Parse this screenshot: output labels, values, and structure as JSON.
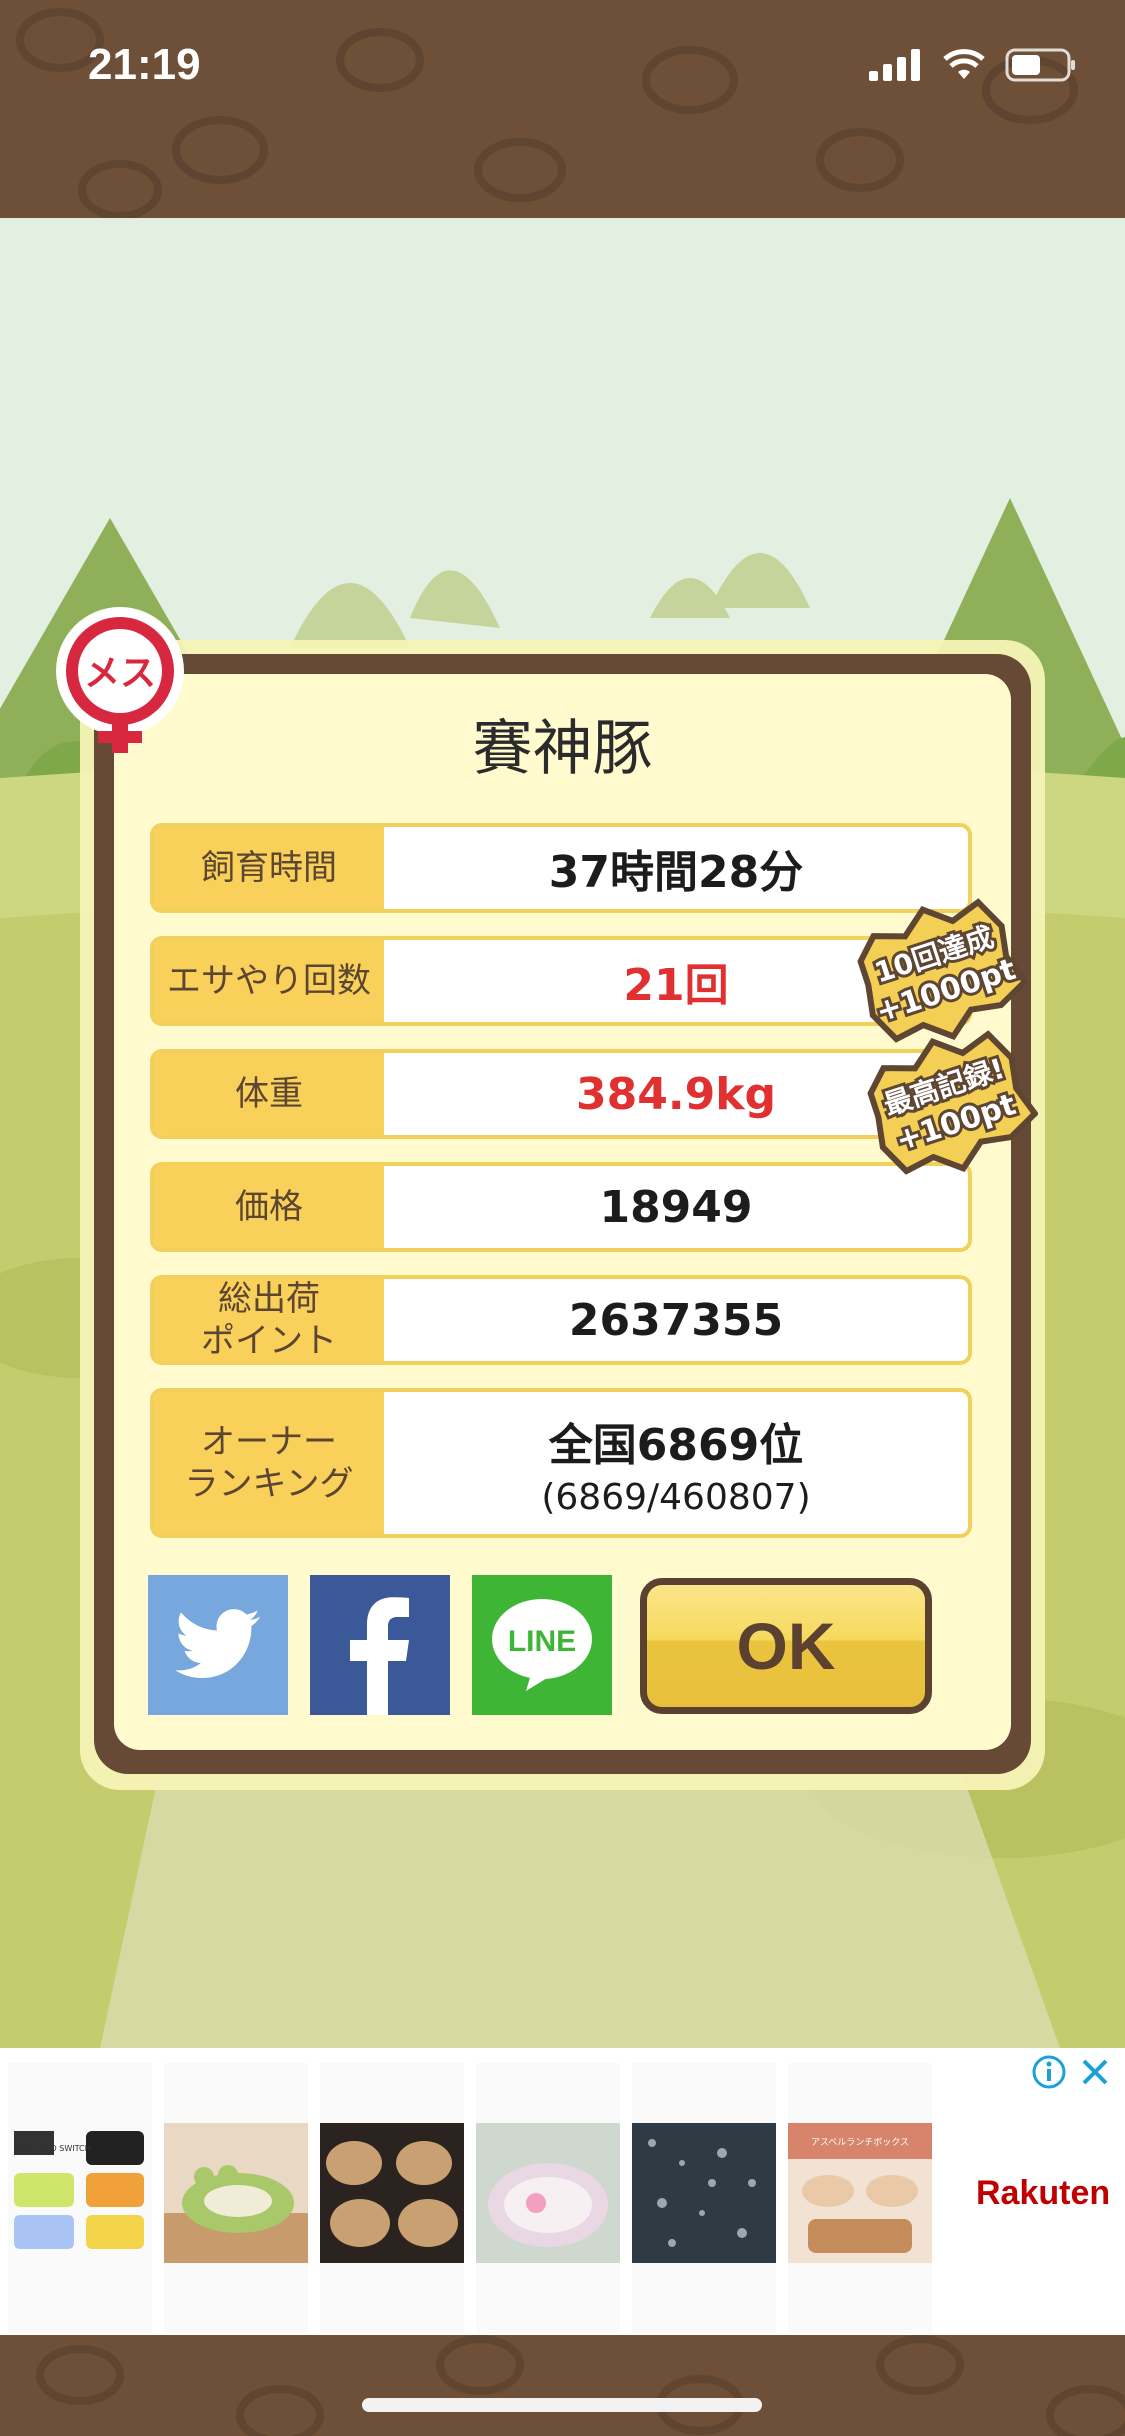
{
  "status_bar": {
    "time": "21:19"
  },
  "female_badge": {
    "text": "メス"
  },
  "result": {
    "title": "賽神豚",
    "rows": [
      {
        "label": "飼育時間",
        "value": "37時間28分",
        "highlight": false
      },
      {
        "label": "エサやり回数",
        "value": "21回",
        "highlight": true
      },
      {
        "label": "体重",
        "value": "384.9kg",
        "highlight": true
      },
      {
        "label": "価格",
        "value": "18949",
        "highlight": false
      },
      {
        "label": "総出荷\nポイント",
        "value": "2637355",
        "highlight": false
      },
      {
        "label": "オーナー\nランキング",
        "value": "全国6869位",
        "sub": "(6869/460807)",
        "highlight": false
      }
    ],
    "bonus_badges": [
      {
        "line1": "10回達成",
        "line2": "+1000pt"
      },
      {
        "line1": "最高記録!",
        "line2": "+100pt"
      }
    ],
    "share_buttons": [
      {
        "name": "twitter",
        "color": "#76a7dd"
      },
      {
        "name": "facebook",
        "color": "#3b5998"
      },
      {
        "name": "line",
        "color": "#3fb536",
        "text": "LINE"
      }
    ],
    "ok_label": "OK"
  },
  "ad": {
    "brand": "Rakuten",
    "thumb_switch_text": "NINTENDO SWITCH",
    "thumb_bento_text": "アスベルランチボックス"
  }
}
